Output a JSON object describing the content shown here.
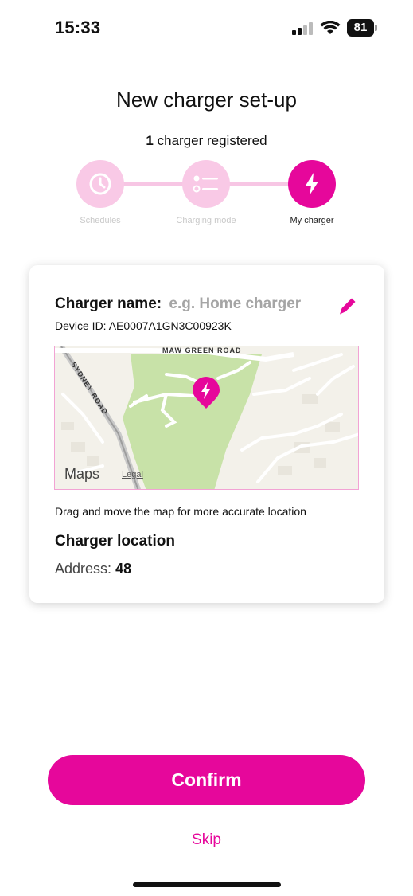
{
  "status_bar": {
    "time": "15:33",
    "battery": "81"
  },
  "header": {
    "title": "New charger set-up",
    "registered_count": "1",
    "registered_text": "charger registered"
  },
  "stepper": {
    "steps": [
      {
        "label": "Schedules",
        "icon": "clock-icon",
        "state": "inactive"
      },
      {
        "label": "Charging mode",
        "icon": "list-icon",
        "state": "inactive"
      },
      {
        "label": "My charger",
        "icon": "bolt-icon",
        "state": "active"
      }
    ]
  },
  "card": {
    "name_label": "Charger name:",
    "name_placeholder": "e.g. Home charger",
    "device_id": "Device ID: AE0007A1GN3C00923K",
    "map": {
      "road_1": "MAW GREEN ROAD",
      "road_2": "SYDNEY ROAD",
      "maps_brand": "Maps",
      "legal": "Legal"
    },
    "map_hint": "Drag and move the map for more accurate location",
    "location_title": "Charger location",
    "address_label": "Address:",
    "address_value": "48"
  },
  "actions": {
    "confirm": "Confirm",
    "skip": "Skip"
  },
  "colors": {
    "accent": "#e6079b",
    "accent_light": "#f9c9e6"
  }
}
